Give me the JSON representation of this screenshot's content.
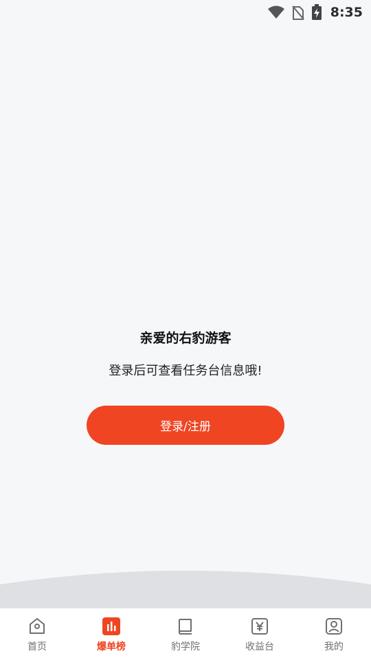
{
  "status_bar": {
    "time": "8:35",
    "icons": [
      "wifi-icon",
      "no-sim-icon",
      "battery-charging-icon"
    ]
  },
  "main": {
    "greeting": "亲爱的右豹游客",
    "subtext": "登录后可查看任务台信息哦!",
    "login_button_label": "登录/注册"
  },
  "tabbar": {
    "active_index": 1,
    "accent_color": "#ef4523",
    "tabs": [
      {
        "label": "首页",
        "icon": "home-icon"
      },
      {
        "label": "爆单榜",
        "icon": "bar-chart-icon"
      },
      {
        "label": "豹学院",
        "icon": "book-icon"
      },
      {
        "label": "收益台",
        "icon": "yen-icon"
      },
      {
        "label": "我的",
        "icon": "profile-icon"
      }
    ]
  }
}
